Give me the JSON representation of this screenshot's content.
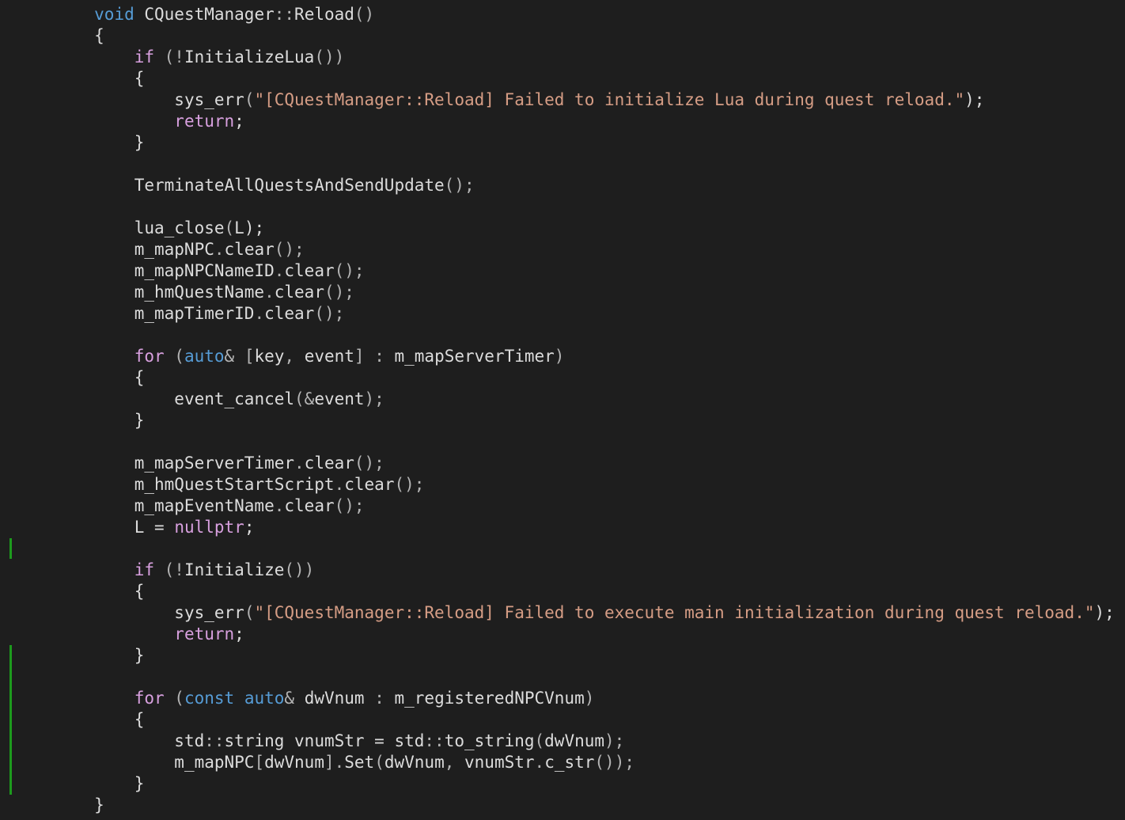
{
  "editor": {
    "background_color": "#1e1e1e",
    "change_marker_color": "#1d9a1d",
    "token_colors": {
      "keyword": "#569cd6",
      "control_flow": "#d8a0df",
      "string": "#d69d85",
      "identifier": "#dcdcdc",
      "punctuation": "#b4b4b4"
    },
    "lines": [
      [
        {
          "t": "void",
          "c": "kw"
        },
        {
          "t": " CQuestManager",
          "c": "fn"
        },
        {
          "t": "::",
          "c": "punc"
        },
        {
          "t": "Reload",
          "c": "fn"
        },
        {
          "t": "()",
          "c": "punc"
        }
      ],
      [
        {
          "t": "{",
          "c": "plain"
        }
      ],
      [
        {
          "t": "if",
          "c": "flow"
        },
        {
          "t": " (!",
          "c": "punc"
        },
        {
          "t": "InitializeLua",
          "c": "fn"
        },
        {
          "t": "())",
          "c": "punc"
        }
      ],
      [
        {
          "t": "{",
          "c": "plain"
        }
      ],
      [
        {
          "t": "sys_err",
          "c": "fn"
        },
        {
          "t": "(",
          "c": "punc"
        },
        {
          "t": "\"[CQuestManager::Reload] Failed to initialize Lua during quest reload.\"",
          "c": "str"
        },
        {
          "t": ");",
          "c": "plain"
        }
      ],
      [
        {
          "t": "return",
          "c": "flow"
        },
        {
          "t": ";",
          "c": "plain"
        }
      ],
      [
        {
          "t": "}",
          "c": "plain"
        }
      ],
      [],
      [
        {
          "t": "TerminateAllQuestsAndSendUpdate",
          "c": "fn"
        },
        {
          "t": "();",
          "c": "punc"
        }
      ],
      [],
      [
        {
          "t": "lua_close",
          "c": "fn"
        },
        {
          "t": "(",
          "c": "punc"
        },
        {
          "t": "L",
          "c": "fn"
        },
        {
          "t": ");",
          "c": "plain"
        }
      ],
      [
        {
          "t": "m_mapNPC",
          "c": "fn"
        },
        {
          "t": ".",
          "c": "punc"
        },
        {
          "t": "clear",
          "c": "fn"
        },
        {
          "t": "();",
          "c": "punc"
        }
      ],
      [
        {
          "t": "m_mapNPCNameID",
          "c": "fn"
        },
        {
          "t": ".",
          "c": "punc"
        },
        {
          "t": "clear",
          "c": "fn"
        },
        {
          "t": "();",
          "c": "punc"
        }
      ],
      [
        {
          "t": "m_hmQuestName",
          "c": "fn"
        },
        {
          "t": ".",
          "c": "punc"
        },
        {
          "t": "clear",
          "c": "fn"
        },
        {
          "t": "();",
          "c": "punc"
        }
      ],
      [
        {
          "t": "m_mapTimerID",
          "c": "fn"
        },
        {
          "t": ".",
          "c": "punc"
        },
        {
          "t": "clear",
          "c": "fn"
        },
        {
          "t": "();",
          "c": "punc"
        }
      ],
      [],
      [
        {
          "t": "for",
          "c": "flow"
        },
        {
          "t": " (",
          "c": "punc"
        },
        {
          "t": "auto",
          "c": "kw"
        },
        {
          "t": "& [",
          "c": "punc"
        },
        {
          "t": "key",
          "c": "fn"
        },
        {
          "t": ", ",
          "c": "punc"
        },
        {
          "t": "event",
          "c": "fn"
        },
        {
          "t": "] : ",
          "c": "punc"
        },
        {
          "t": "m_mapServerTimer",
          "c": "fn"
        },
        {
          "t": ")",
          "c": "punc"
        }
      ],
      [
        {
          "t": "{",
          "c": "plain"
        }
      ],
      [
        {
          "t": "event_cancel",
          "c": "fn"
        },
        {
          "t": "(&",
          "c": "punc"
        },
        {
          "t": "event",
          "c": "fn"
        },
        {
          "t": ");",
          "c": "punc"
        }
      ],
      [
        {
          "t": "}",
          "c": "plain"
        }
      ],
      [],
      [
        {
          "t": "m_mapServerTimer",
          "c": "fn"
        },
        {
          "t": ".",
          "c": "punc"
        },
        {
          "t": "clear",
          "c": "fn"
        },
        {
          "t": "();",
          "c": "punc"
        }
      ],
      [
        {
          "t": "m_hmQuestStartScript",
          "c": "fn"
        },
        {
          "t": ".",
          "c": "punc"
        },
        {
          "t": "clear",
          "c": "fn"
        },
        {
          "t": "();",
          "c": "punc"
        }
      ],
      [
        {
          "t": "m_mapEventName",
          "c": "fn"
        },
        {
          "t": ".",
          "c": "punc"
        },
        {
          "t": "clear",
          "c": "fn"
        },
        {
          "t": "();",
          "c": "punc"
        }
      ],
      [
        {
          "t": "L",
          "c": "fn"
        },
        {
          "t": " = ",
          "c": "plain"
        },
        {
          "t": "nullptr",
          "c": "flow"
        },
        {
          "t": ";",
          "c": "plain"
        }
      ],
      [],
      [
        {
          "t": "if",
          "c": "flow"
        },
        {
          "t": " (!",
          "c": "punc"
        },
        {
          "t": "Initialize",
          "c": "fn"
        },
        {
          "t": "())",
          "c": "punc"
        }
      ],
      [
        {
          "t": "{",
          "c": "plain"
        }
      ],
      [
        {
          "t": "sys_err",
          "c": "fn"
        },
        {
          "t": "(",
          "c": "punc"
        },
        {
          "t": "\"[CQuestManager::Reload] Failed to execute main initialization during quest reload.\"",
          "c": "str"
        },
        {
          "t": ");",
          "c": "plain"
        }
      ],
      [
        {
          "t": "return",
          "c": "flow"
        },
        {
          "t": ";",
          "c": "plain"
        }
      ],
      [
        {
          "t": "}",
          "c": "plain"
        }
      ],
      [],
      [
        {
          "t": "for",
          "c": "flow"
        },
        {
          "t": " (",
          "c": "punc"
        },
        {
          "t": "const",
          "c": "kw"
        },
        {
          "t": " ",
          "c": "plain"
        },
        {
          "t": "auto",
          "c": "kw"
        },
        {
          "t": "& ",
          "c": "punc"
        },
        {
          "t": "dwVnum",
          "c": "fn"
        },
        {
          "t": " : ",
          "c": "punc"
        },
        {
          "t": "m_registeredNPCVnum",
          "c": "fn"
        },
        {
          "t": ")",
          "c": "punc"
        }
      ],
      [
        {
          "t": "{",
          "c": "plain"
        }
      ],
      [
        {
          "t": "std",
          "c": "fn"
        },
        {
          "t": "::",
          "c": "punc"
        },
        {
          "t": "string",
          "c": "fn"
        },
        {
          "t": " vnumStr = ",
          "c": "plain"
        },
        {
          "t": "std",
          "c": "fn"
        },
        {
          "t": "::",
          "c": "punc"
        },
        {
          "t": "to_string",
          "c": "fn"
        },
        {
          "t": "(",
          "c": "punc"
        },
        {
          "t": "dwVnum",
          "c": "fn"
        },
        {
          "t": ");",
          "c": "punc"
        }
      ],
      [
        {
          "t": "m_mapNPC",
          "c": "fn"
        },
        {
          "t": "[",
          "c": "punc"
        },
        {
          "t": "dwVnum",
          "c": "fn"
        },
        {
          "t": "].",
          "c": "punc"
        },
        {
          "t": "Set",
          "c": "fn"
        },
        {
          "t": "(",
          "c": "punc"
        },
        {
          "t": "dwVnum",
          "c": "fn"
        },
        {
          "t": ", ",
          "c": "punc"
        },
        {
          "t": "vnumStr",
          "c": "fn"
        },
        {
          "t": ".",
          "c": "punc"
        },
        {
          "t": "c_str",
          "c": "fn"
        },
        {
          "t": "());",
          "c": "punc"
        }
      ],
      [
        {
          "t": "}",
          "c": "plain"
        }
      ],
      [
        {
          "t": "}",
          "c": "plain"
        }
      ]
    ]
  }
}
